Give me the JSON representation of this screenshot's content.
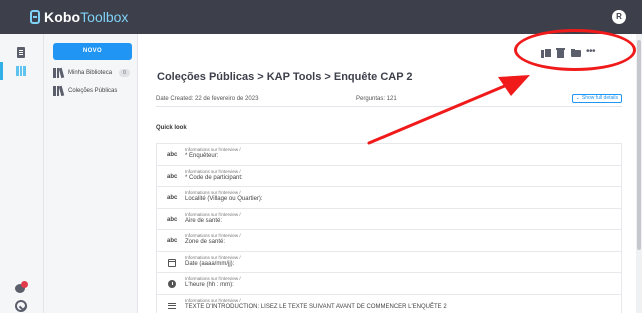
{
  "app": {
    "logo_part_a": "Kobo",
    "logo_part_b": "Toolbox",
    "avatar_initial": "R"
  },
  "sidebar": {
    "new_button": "NOVO",
    "items": [
      {
        "label": "Minha Biblioteca",
        "badge": "0"
      },
      {
        "label": "Coleções Públicas"
      }
    ]
  },
  "header": {
    "breadcrumb": "Coleções Públicas > KAP Tools > Enquête CAP 2",
    "date_created": "Date Created: 22 de fevereiro de 2023",
    "questions": "Perguntas: 121",
    "show_full_details": "Show full details"
  },
  "actions": {
    "icons": [
      "clone-icon",
      "delete-icon",
      "folder-icon",
      "more-options-icon"
    ],
    "more_glyph": "•••"
  },
  "quicklook": {
    "title": "Quick look",
    "rows": [
      {
        "type": "text",
        "type_label": "abc",
        "group": "Informations sur l'interview /",
        "label": "* Enquêteur:"
      },
      {
        "type": "text",
        "type_label": "abc",
        "group": "Informations sur l'interview /",
        "label": "* Code de participant:"
      },
      {
        "type": "text",
        "type_label": "abc",
        "group": "Informations sur l'interview /",
        "label": "Localité (Village ou Quartier):"
      },
      {
        "type": "text",
        "type_label": "abc",
        "group": "Informations sur l'interview /",
        "label": "Aire de santé:"
      },
      {
        "type": "text",
        "type_label": "abc",
        "group": "Informations sur l'interview /",
        "label": "Zone de santé:"
      },
      {
        "type": "date",
        "group": "Informations sur l'interview /",
        "label": "Date (aaaa/mm/jj):"
      },
      {
        "type": "time",
        "group": "Informations sur l'interview /",
        "label": "L'heure (hh : mm):"
      },
      {
        "type": "note",
        "group": "Informations sur l'interview /",
        "label": "TEXTE D'INTRODUCTION: LISEZ LE TEXTE SUIVANT AVANT DE COMMENCER L'ENQUÊTE 2"
      }
    ]
  },
  "colors": {
    "topbar": "#3d3f4a",
    "accent": "#2095f3",
    "logo_accent": "#7fd3f7",
    "annotation": "#f01a1a"
  }
}
